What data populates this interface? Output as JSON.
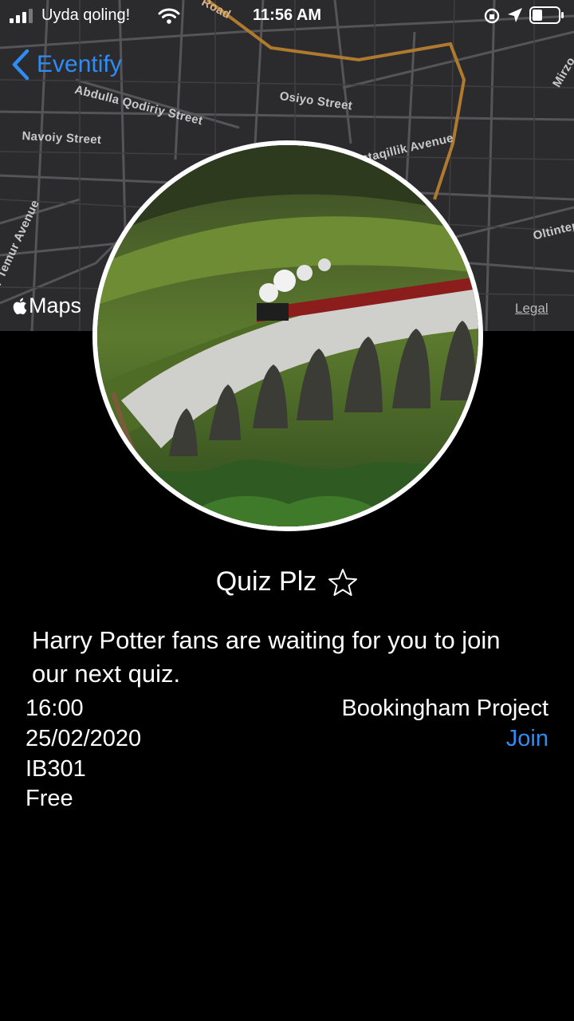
{
  "status_bar": {
    "carrier": "Uyda qoling!",
    "time": "11:56 AM"
  },
  "nav": {
    "back_label": "Eventify"
  },
  "map": {
    "streets": [
      "Abdulla Qodiriy Street",
      "Osiyo Street",
      "Navoiy Street",
      "Mustaqillik Avenue",
      "Oltintepa",
      "Amir Temur Avenue",
      "Mirzo",
      "Road"
    ],
    "attribution": "Maps",
    "legal_label": "Legal",
    "route_color": "#b07a2e"
  },
  "event": {
    "title": "Quiz Plz",
    "description": "Harry Potter fans are waiting for you to join our next quiz.",
    "time": "16:00",
    "date": "25/02/2020",
    "room": "IB301",
    "price": "Free",
    "organizer": "Bookingham Project",
    "join_label": "Join"
  },
  "colors": {
    "accent": "#2f8cf5",
    "background": "#000000"
  }
}
